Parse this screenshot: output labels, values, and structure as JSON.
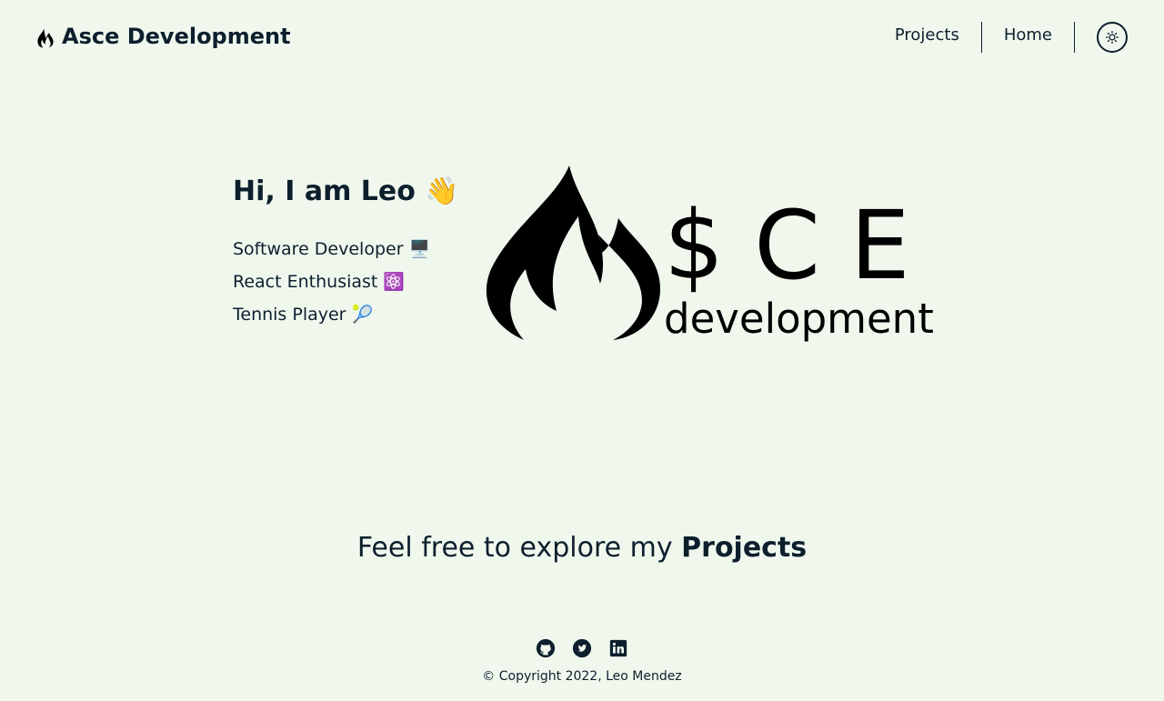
{
  "header": {
    "brand_icon": "flame-icon",
    "brand_text": "Asce Development",
    "nav": [
      {
        "label": "Projects"
      },
      {
        "label": "Home"
      }
    ],
    "theme_toggle_icon": "sun-icon"
  },
  "hero": {
    "greeting": "Hi, I am Leo 👋",
    "roles": [
      "Software Developer 🖥️",
      "React Enthusiast ⚛️",
      "Tennis Player 🎾"
    ],
    "logo": {
      "letters": "$ C E",
      "subtitle": "development"
    }
  },
  "cta": {
    "prefix": "Feel free to explore my ",
    "link_text": "Projects"
  },
  "footer": {
    "socials": [
      {
        "icon": "github-icon"
      },
      {
        "icon": "twitter-icon"
      },
      {
        "icon": "linkedin-icon"
      }
    ],
    "copyright": "© Copyright 2022, Leo Mendez"
  },
  "colors": {
    "background": "#f0f8ee",
    "text": "#0d1f2d"
  }
}
